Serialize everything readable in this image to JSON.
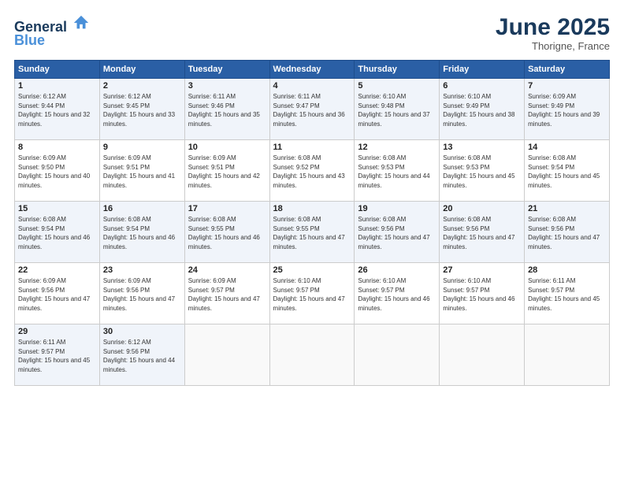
{
  "header": {
    "logo_line1": "General",
    "logo_line2": "Blue",
    "month": "June 2025",
    "location": "Thorigne, France"
  },
  "weekdays": [
    "Sunday",
    "Monday",
    "Tuesday",
    "Wednesday",
    "Thursday",
    "Friday",
    "Saturday"
  ],
  "weeks": [
    [
      {
        "day": "1",
        "sunrise": "Sunrise: 6:12 AM",
        "sunset": "Sunset: 9:44 PM",
        "daylight": "Daylight: 15 hours and 32 minutes."
      },
      {
        "day": "2",
        "sunrise": "Sunrise: 6:12 AM",
        "sunset": "Sunset: 9:45 PM",
        "daylight": "Daylight: 15 hours and 33 minutes."
      },
      {
        "day": "3",
        "sunrise": "Sunrise: 6:11 AM",
        "sunset": "Sunset: 9:46 PM",
        "daylight": "Daylight: 15 hours and 35 minutes."
      },
      {
        "day": "4",
        "sunrise": "Sunrise: 6:11 AM",
        "sunset": "Sunset: 9:47 PM",
        "daylight": "Daylight: 15 hours and 36 minutes."
      },
      {
        "day": "5",
        "sunrise": "Sunrise: 6:10 AM",
        "sunset": "Sunset: 9:48 PM",
        "daylight": "Daylight: 15 hours and 37 minutes."
      },
      {
        "day": "6",
        "sunrise": "Sunrise: 6:10 AM",
        "sunset": "Sunset: 9:49 PM",
        "daylight": "Daylight: 15 hours and 38 minutes."
      },
      {
        "day": "7",
        "sunrise": "Sunrise: 6:09 AM",
        "sunset": "Sunset: 9:49 PM",
        "daylight": "Daylight: 15 hours and 39 minutes."
      }
    ],
    [
      {
        "day": "8",
        "sunrise": "Sunrise: 6:09 AM",
        "sunset": "Sunset: 9:50 PM",
        "daylight": "Daylight: 15 hours and 40 minutes."
      },
      {
        "day": "9",
        "sunrise": "Sunrise: 6:09 AM",
        "sunset": "Sunset: 9:51 PM",
        "daylight": "Daylight: 15 hours and 41 minutes."
      },
      {
        "day": "10",
        "sunrise": "Sunrise: 6:09 AM",
        "sunset": "Sunset: 9:51 PM",
        "daylight": "Daylight: 15 hours and 42 minutes."
      },
      {
        "day": "11",
        "sunrise": "Sunrise: 6:08 AM",
        "sunset": "Sunset: 9:52 PM",
        "daylight": "Daylight: 15 hours and 43 minutes."
      },
      {
        "day": "12",
        "sunrise": "Sunrise: 6:08 AM",
        "sunset": "Sunset: 9:53 PM",
        "daylight": "Daylight: 15 hours and 44 minutes."
      },
      {
        "day": "13",
        "sunrise": "Sunrise: 6:08 AM",
        "sunset": "Sunset: 9:53 PM",
        "daylight": "Daylight: 15 hours and 45 minutes."
      },
      {
        "day": "14",
        "sunrise": "Sunrise: 6:08 AM",
        "sunset": "Sunset: 9:54 PM",
        "daylight": "Daylight: 15 hours and 45 minutes."
      }
    ],
    [
      {
        "day": "15",
        "sunrise": "Sunrise: 6:08 AM",
        "sunset": "Sunset: 9:54 PM",
        "daylight": "Daylight: 15 hours and 46 minutes."
      },
      {
        "day": "16",
        "sunrise": "Sunrise: 6:08 AM",
        "sunset": "Sunset: 9:54 PM",
        "daylight": "Daylight: 15 hours and 46 minutes."
      },
      {
        "day": "17",
        "sunrise": "Sunrise: 6:08 AM",
        "sunset": "Sunset: 9:55 PM",
        "daylight": "Daylight: 15 hours and 46 minutes."
      },
      {
        "day": "18",
        "sunrise": "Sunrise: 6:08 AM",
        "sunset": "Sunset: 9:55 PM",
        "daylight": "Daylight: 15 hours and 47 minutes."
      },
      {
        "day": "19",
        "sunrise": "Sunrise: 6:08 AM",
        "sunset": "Sunset: 9:56 PM",
        "daylight": "Daylight: 15 hours and 47 minutes."
      },
      {
        "day": "20",
        "sunrise": "Sunrise: 6:08 AM",
        "sunset": "Sunset: 9:56 PM",
        "daylight": "Daylight: 15 hours and 47 minutes."
      },
      {
        "day": "21",
        "sunrise": "Sunrise: 6:08 AM",
        "sunset": "Sunset: 9:56 PM",
        "daylight": "Daylight: 15 hours and 47 minutes."
      }
    ],
    [
      {
        "day": "22",
        "sunrise": "Sunrise: 6:09 AM",
        "sunset": "Sunset: 9:56 PM",
        "daylight": "Daylight: 15 hours and 47 minutes."
      },
      {
        "day": "23",
        "sunrise": "Sunrise: 6:09 AM",
        "sunset": "Sunset: 9:56 PM",
        "daylight": "Daylight: 15 hours and 47 minutes."
      },
      {
        "day": "24",
        "sunrise": "Sunrise: 6:09 AM",
        "sunset": "Sunset: 9:57 PM",
        "daylight": "Daylight: 15 hours and 47 minutes."
      },
      {
        "day": "25",
        "sunrise": "Sunrise: 6:10 AM",
        "sunset": "Sunset: 9:57 PM",
        "daylight": "Daylight: 15 hours and 47 minutes."
      },
      {
        "day": "26",
        "sunrise": "Sunrise: 6:10 AM",
        "sunset": "Sunset: 9:57 PM",
        "daylight": "Daylight: 15 hours and 46 minutes."
      },
      {
        "day": "27",
        "sunrise": "Sunrise: 6:10 AM",
        "sunset": "Sunset: 9:57 PM",
        "daylight": "Daylight: 15 hours and 46 minutes."
      },
      {
        "day": "28",
        "sunrise": "Sunrise: 6:11 AM",
        "sunset": "Sunset: 9:57 PM",
        "daylight": "Daylight: 15 hours and 45 minutes."
      }
    ],
    [
      {
        "day": "29",
        "sunrise": "Sunrise: 6:11 AM",
        "sunset": "Sunset: 9:57 PM",
        "daylight": "Daylight: 15 hours and 45 minutes."
      },
      {
        "day": "30",
        "sunrise": "Sunrise: 6:12 AM",
        "sunset": "Sunset: 9:56 PM",
        "daylight": "Daylight: 15 hours and 44 minutes."
      },
      {
        "day": "",
        "sunrise": "",
        "sunset": "",
        "daylight": ""
      },
      {
        "day": "",
        "sunrise": "",
        "sunset": "",
        "daylight": ""
      },
      {
        "day": "",
        "sunrise": "",
        "sunset": "",
        "daylight": ""
      },
      {
        "day": "",
        "sunrise": "",
        "sunset": "",
        "daylight": ""
      },
      {
        "day": "",
        "sunrise": "",
        "sunset": "",
        "daylight": ""
      }
    ]
  ]
}
